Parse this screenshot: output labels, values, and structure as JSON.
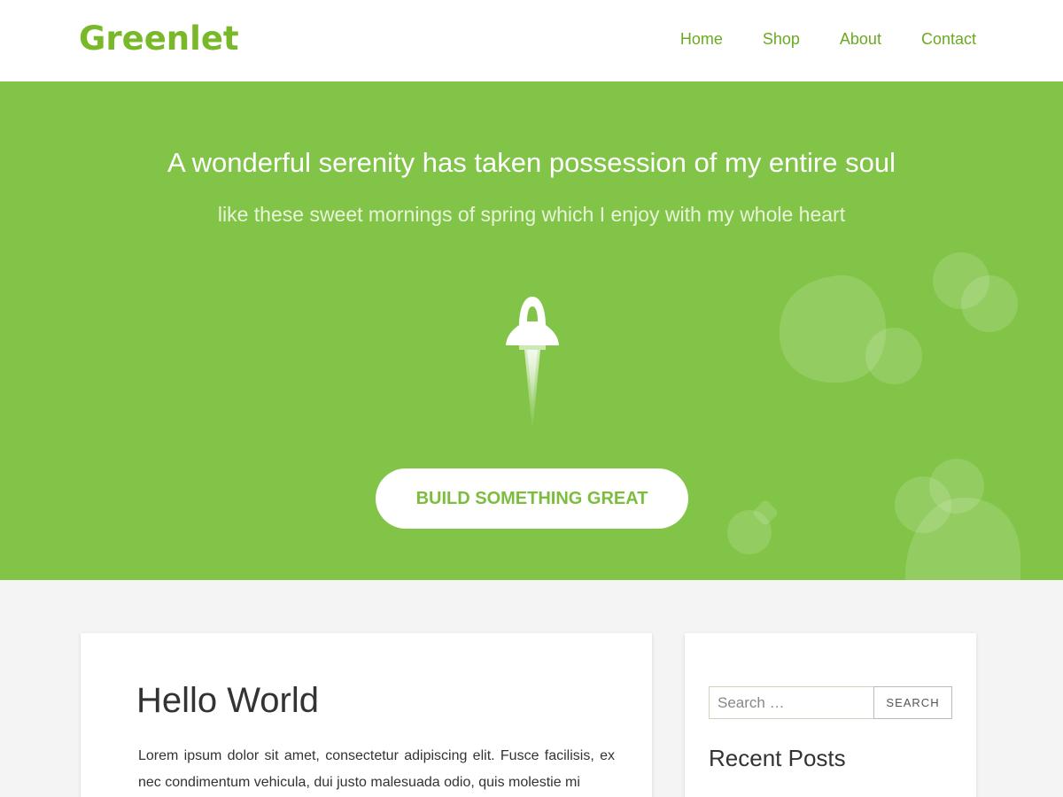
{
  "brand": {
    "name": "Greenlet",
    "color": "#79b829"
  },
  "nav": {
    "items": [
      {
        "label": "Home"
      },
      {
        "label": "Shop"
      },
      {
        "label": "About"
      },
      {
        "label": "Contact"
      }
    ]
  },
  "hero": {
    "title": "A wonderful serenity has taken possession of my entire soul",
    "subtitle": "like these sweet mornings of spring which I enjoy with my whole heart",
    "icon": "rocket-icon",
    "cta_label": "BUILD SOMETHING GREAT",
    "background": "#82c448"
  },
  "post": {
    "title": "Hello World",
    "excerpt": "Lorem ipsum dolor sit amet, consectetur adipiscing elit. Fusce facilisis, ex nec condimentum vehicula, dui justo malesuada odio, quis molestie mi"
  },
  "sidebar": {
    "search": {
      "placeholder": "Search …",
      "button_label": "SEARCH"
    },
    "recent_posts_title": "Recent Posts"
  }
}
